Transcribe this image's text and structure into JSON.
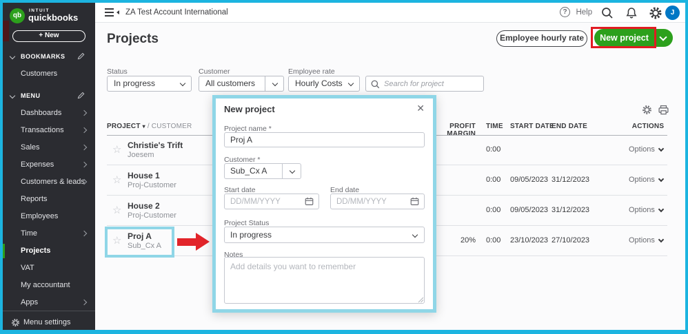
{
  "colors": {
    "brand_green": "#2ca01c",
    "avatar_blue": "#0077c5",
    "annotation_red": "#e11b22",
    "highlight_cyan": "#8fd6e7",
    "frame_cyan": "#1cb4e0",
    "sidebar_bg": "#2b2c31"
  },
  "icons": {
    "help_glyph": "?",
    "star_glyph": "☆",
    "sort_desc_glyph": "▾",
    "close_glyph": "✕"
  },
  "sidebar": {
    "brand_top": "INTUIT",
    "brand_bottom": "quickbooks",
    "logo_glyph": "qb",
    "new_button": "+  New",
    "bookmarks_header": "BOOKMARKS",
    "bookmark_items": [
      {
        "label": "Customers"
      }
    ],
    "menu_header": "MENU",
    "menu_items": [
      {
        "label": "Dashboards"
      },
      {
        "label": "Transactions"
      },
      {
        "label": "Sales"
      },
      {
        "label": "Expenses"
      },
      {
        "label": "Customers & leads"
      },
      {
        "label": "Reports"
      },
      {
        "label": "Employees"
      },
      {
        "label": "Time"
      },
      {
        "label": "Projects"
      },
      {
        "label": "VAT"
      },
      {
        "label": "My accountant"
      },
      {
        "label": "Apps"
      }
    ],
    "menu_settings": "Menu settings"
  },
  "topbar": {
    "account_name": "ZA Test Account International",
    "help_label": "Help",
    "avatar_initial": "J"
  },
  "header": {
    "title": "Projects",
    "employee_hourly_rate_button": "Employee hourly rate",
    "new_project_button": "New project"
  },
  "filters": {
    "status": {
      "label": "Status",
      "value": "In progress"
    },
    "customer": {
      "label": "Customer",
      "value": "All customers"
    },
    "employee_rate": {
      "label": "Employee rate",
      "value": "Hourly Costs"
    },
    "search_placeholder": "Search for project"
  },
  "table": {
    "header_project": "PROJECT",
    "header_customer": "/ CUSTOMER",
    "header_profit_margin": "PROFIT MARGIN",
    "header_time": "TIME",
    "header_start_date": "START DATE",
    "header_end_date": "END DATE",
    "header_actions": "ACTIONS",
    "rows": [
      {
        "project": "Christie's Trift",
        "customer": "Joesem",
        "profit_margin": "",
        "time": "0:00",
        "start_date": "",
        "end_date": "",
        "options_label": "Options"
      },
      {
        "project": "House 1",
        "customer": "Proj-Customer",
        "profit_margin": "",
        "time": "0:00",
        "start_date": "09/05/2023",
        "end_date": "31/12/2023",
        "options_label": "Options"
      },
      {
        "project": "House 2",
        "customer": "Proj-Customer",
        "profit_margin": "",
        "time": "0:00",
        "start_date": "09/05/2023",
        "end_date": "31/12/2023",
        "options_label": "Options"
      },
      {
        "project": "Proj A",
        "customer": "Sub_Cx A",
        "profit_margin": "20%",
        "time": "0:00",
        "start_date": "23/10/2023",
        "end_date": "27/10/2023",
        "options_label": "Options"
      }
    ]
  },
  "modal": {
    "title": "New project",
    "project_name": {
      "label": "Project name *",
      "value": "Proj A"
    },
    "customer": {
      "label": "Customer *",
      "value": "Sub_Cx A"
    },
    "start_date": {
      "label": "Start date",
      "placeholder": "DD/MM/YYYY"
    },
    "end_date": {
      "label": "End date",
      "placeholder": "DD/MM/YYYY"
    },
    "project_status": {
      "label": "Project Status",
      "value": "In progress"
    },
    "notes": {
      "label": "Notes",
      "placeholder": "Add details you want to remember"
    }
  }
}
